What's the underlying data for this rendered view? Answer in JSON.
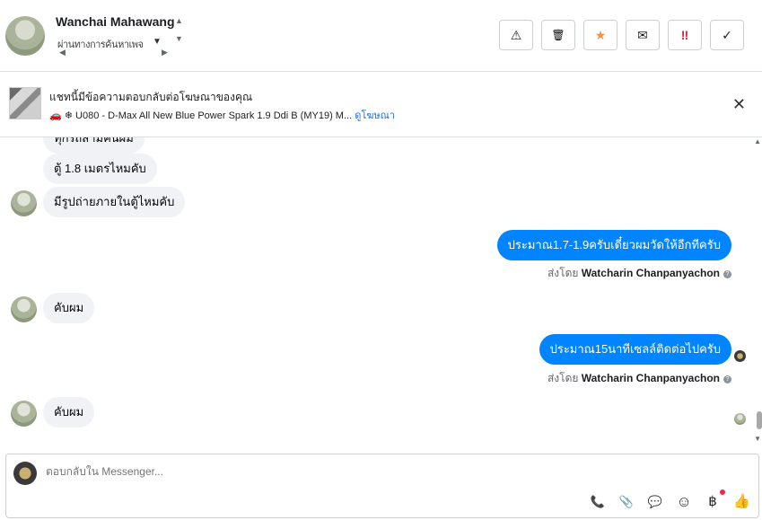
{
  "header": {
    "contact_name": "Wanchai Mahawang",
    "name_up_icon": "▲",
    "name_down_icon": "▼",
    "subtitle": "ผ่านทางการค้นหาเพจ",
    "actions": {
      "spam": "⚠",
      "delete": "🗑",
      "star": "★",
      "unread": "✉",
      "important": "‼",
      "done": "✓"
    }
  },
  "ad": {
    "title": "แชทนี้มีข้อความตอบกลับต่อโฆษณาของคุณ",
    "details": "🚗 ❄ U080 - D-Max All New Blue Power Spark 1.9 Ddi B (MY19) M...",
    "link": "ดูโฆษณา",
    "close": "✕"
  },
  "messages": {
    "m0": "ทุกรถสามคันผม",
    "m1": "ตู้ 1.8 เมตรไหมคับ",
    "m2": "มีรูปถ่ายภายในตู้ไหมคับ",
    "m3": "ประมาณ1.7-1.9ครับเดี๋ยวผมวัดให้อีกทีครับ",
    "m3_sent_prefix": "ส่งโดย",
    "m3_sender": "Watcharin Chanpanyachon",
    "m4": "คับผม",
    "m5": "ประมาณ15นาทีเซลล์ติดต่อไปครับ",
    "m5_sent_prefix": "ส่งโดย",
    "m5_sender": "Watcharin Chanpanyachon",
    "m6": "คับผม",
    "help": "?"
  },
  "composer": {
    "placeholder": "ตอบกลับใน Messenger..."
  },
  "tools": {
    "call": "📞",
    "attach": "📎",
    "saved_reply": "💬",
    "emoji": "☺",
    "payment": "฿",
    "like": "👍"
  }
}
